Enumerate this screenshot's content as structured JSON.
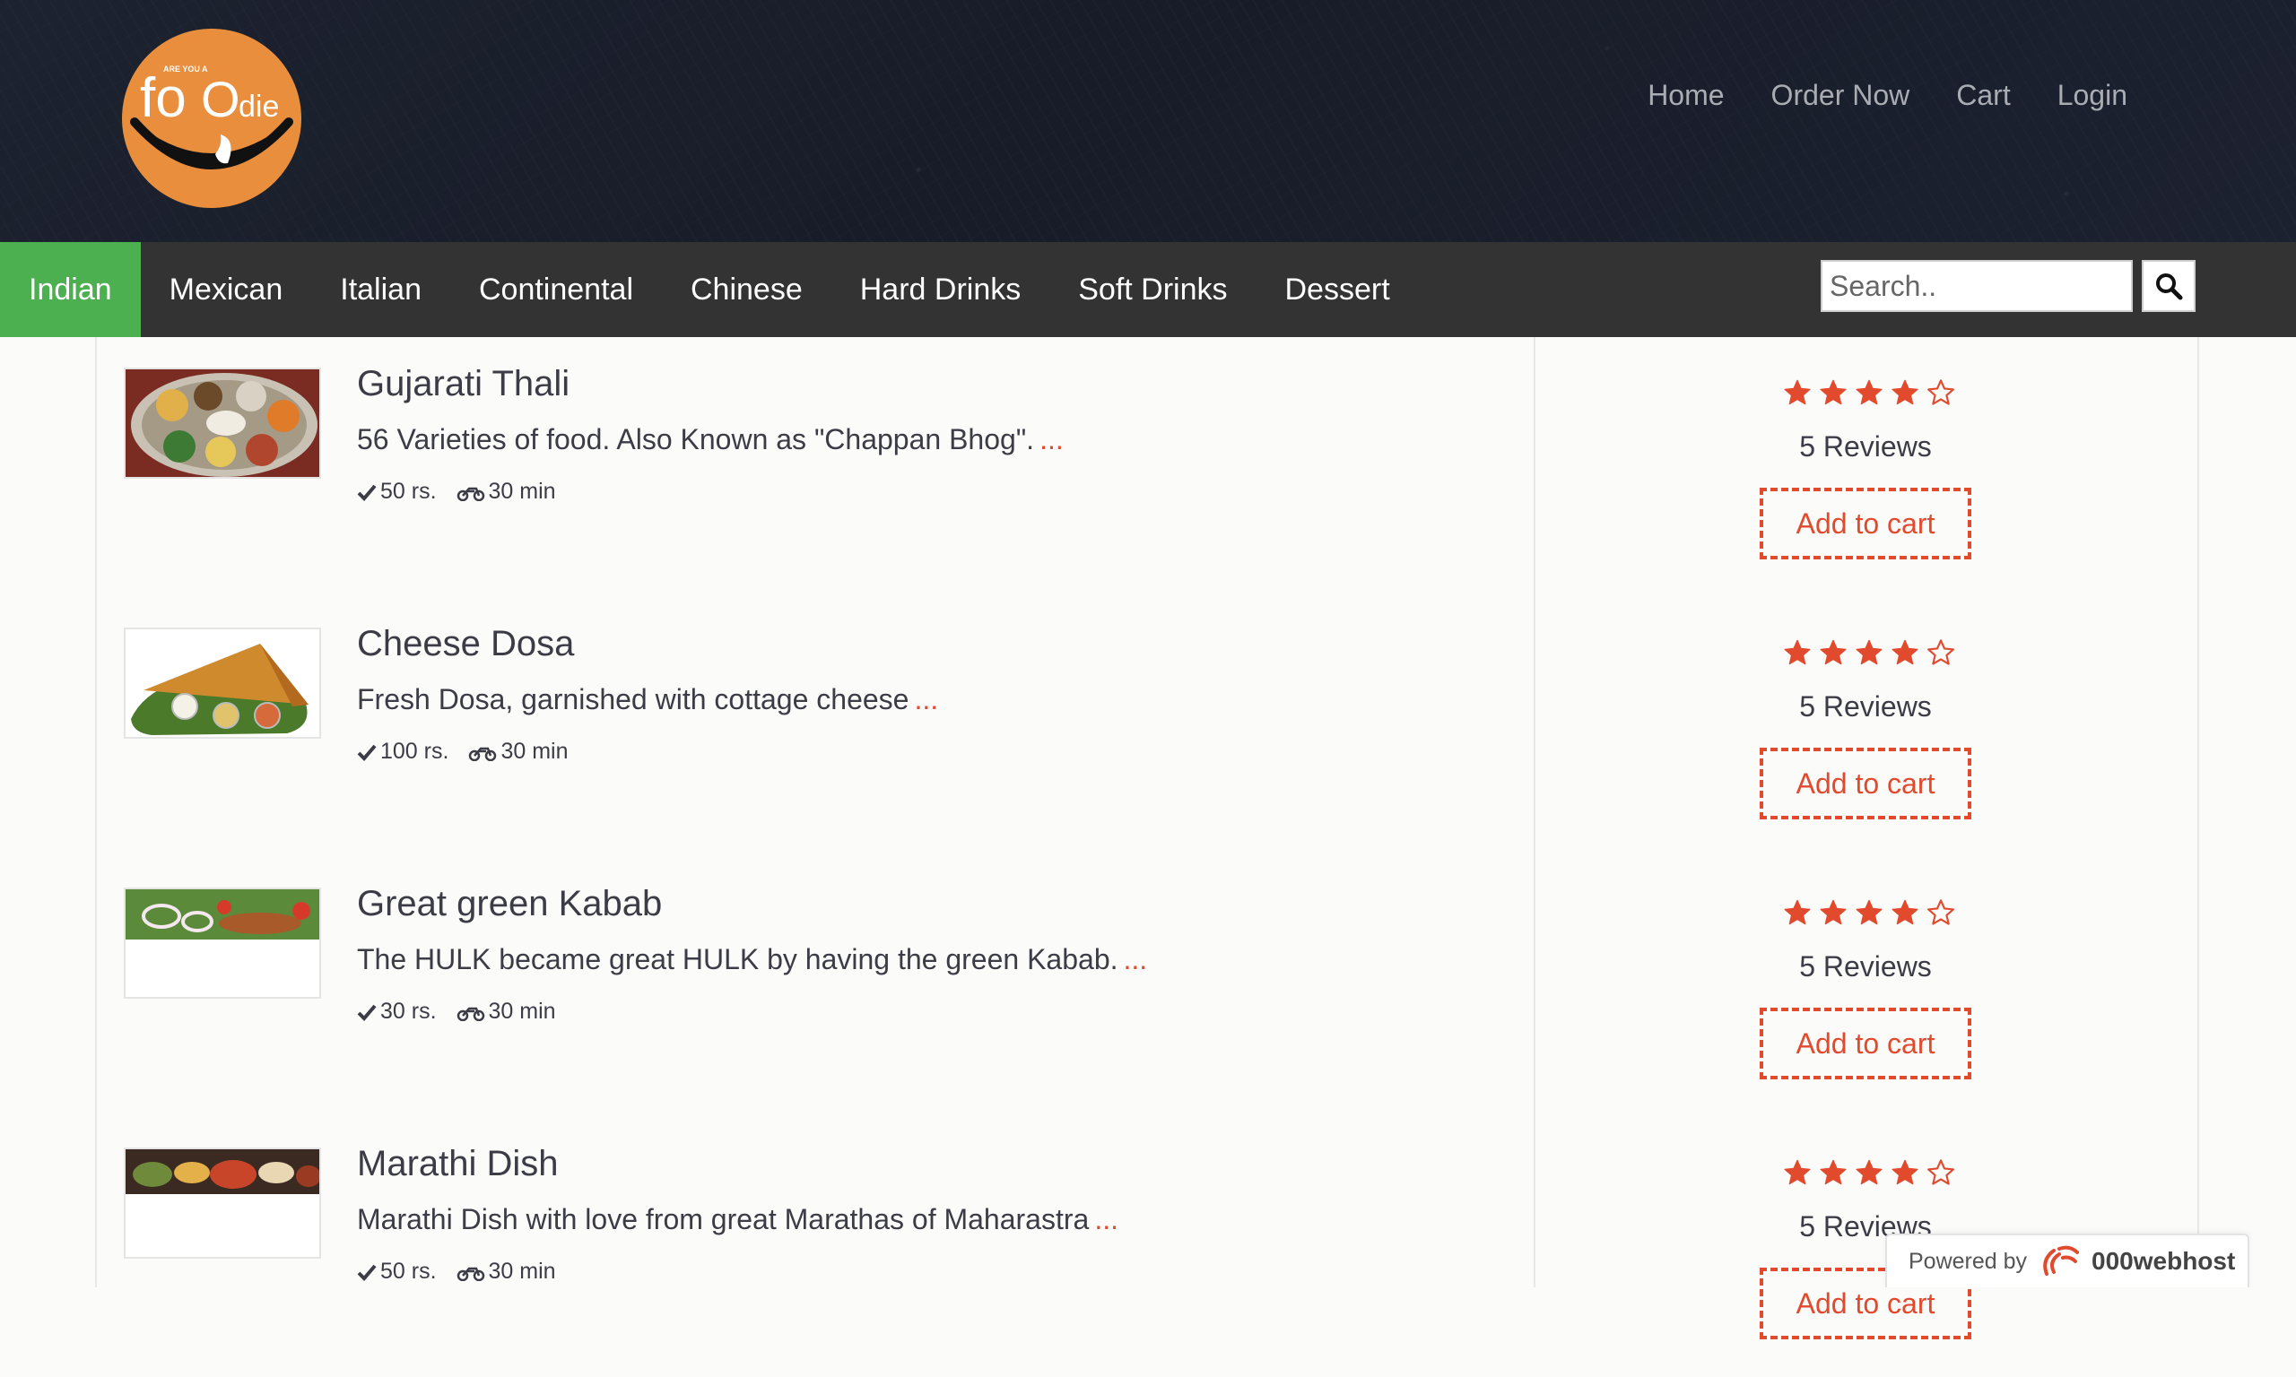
{
  "brand": {
    "logo_small_text": "ARE YOU A",
    "logo_word": "foOdie"
  },
  "top_nav": [
    "Home",
    "Order Now",
    "Cart",
    "Login"
  ],
  "categories": {
    "active": "Indian",
    "items": [
      "Indian",
      "Mexican",
      "Italian",
      "Continental",
      "Chinese",
      "Hard Drinks",
      "Soft Drinks",
      "Dessert"
    ]
  },
  "search": {
    "placeholder": "Search.."
  },
  "items": [
    {
      "title": "Gujarati Thali",
      "description": "56 Varieties of food. Also Known as \"Chappan Bhog\".",
      "more": "...",
      "price": "50 rs.",
      "time": "30 min",
      "rating": 4,
      "rating_max": 5,
      "reviews": "5 Reviews",
      "cart_label": "Add to cart"
    },
    {
      "title": "Cheese Dosa",
      "description": "Fresh Dosa, garnished with cottage cheese",
      "more": "...",
      "price": "100 rs.",
      "time": "30 min",
      "rating": 4,
      "rating_max": 5,
      "reviews": "5 Reviews",
      "cart_label": "Add to cart"
    },
    {
      "title": "Great green Kabab",
      "description": "The HULK became great HULK by having the green Kabab.",
      "more": "...",
      "price": "30 rs.",
      "time": "30 min",
      "rating": 4,
      "rating_max": 5,
      "reviews": "5 Reviews",
      "cart_label": "Add to cart"
    },
    {
      "title": "Marathi Dish",
      "description": "Marathi Dish with love from great Marathas of Maharastra",
      "more": "...",
      "price": "50 rs.",
      "time": "30 min",
      "rating": 4,
      "rating_max": 5,
      "reviews": "5 Reviews",
      "cart_label": "Add to cart"
    }
  ],
  "powered_badge": {
    "prefix": "Powered by",
    "brand": "000webhost"
  },
  "colors": {
    "accent_red": "#e24a2e",
    "active_category": "#4caf50",
    "category_bar": "#333333",
    "header_bg": "#1b1f2b",
    "logo_orange": "#e98e3c"
  },
  "icons": {
    "search": "magnifier-icon",
    "price": "checkmark-icon",
    "delivery": "motorbike-icon",
    "star_full": "star-filled-icon",
    "star_empty": "star-outline-icon"
  }
}
